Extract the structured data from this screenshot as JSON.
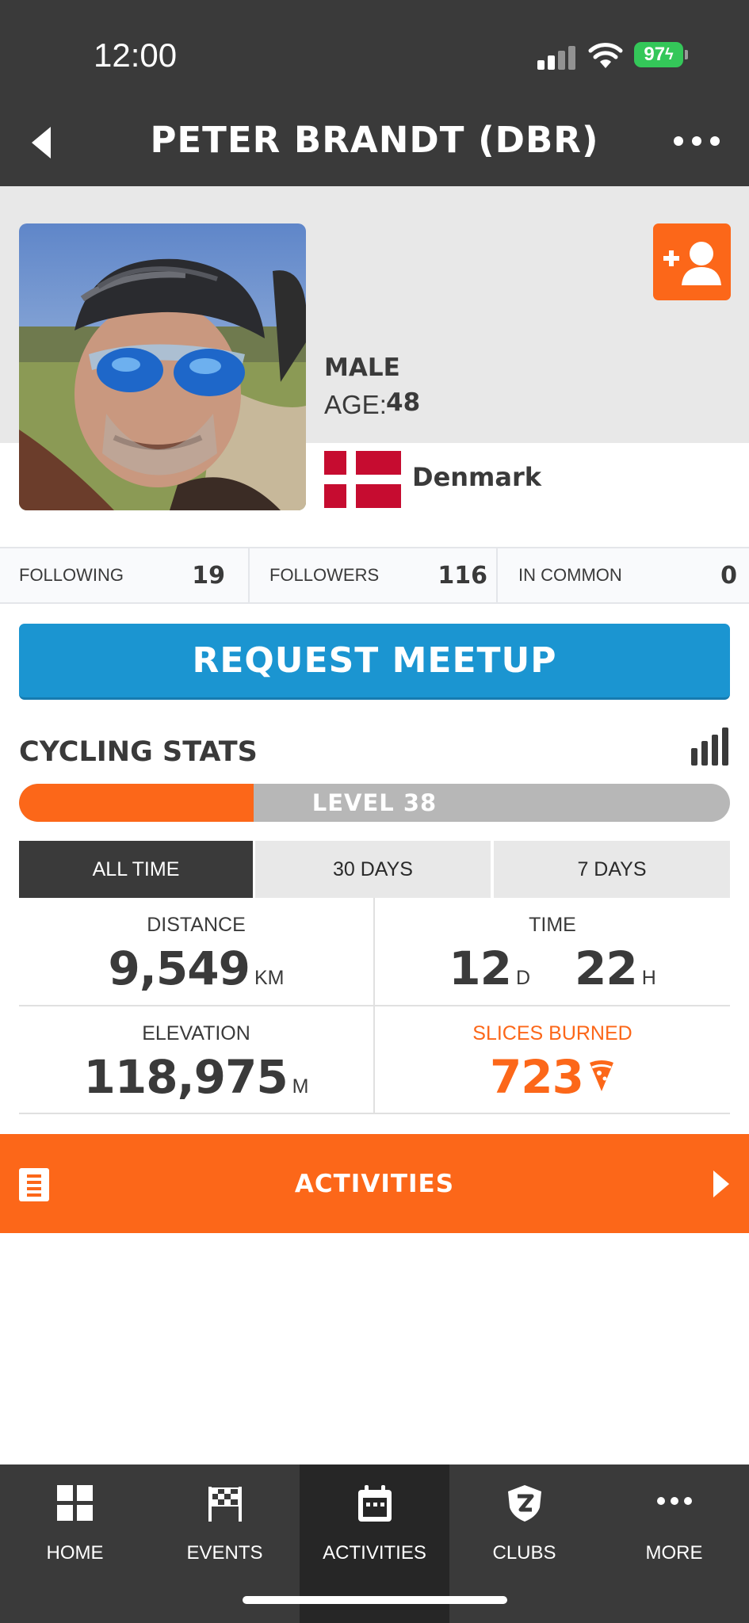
{
  "status_bar": {
    "time": "12:00",
    "battery": "97"
  },
  "header": {
    "title": "PETER BRANDT (DBR)"
  },
  "profile": {
    "gender": "MALE",
    "age_label": "AGE:",
    "age": "48",
    "country": "Denmark"
  },
  "social": {
    "following_label": "FOLLOWING",
    "following": "19",
    "followers_label": "FOLLOWERS",
    "followers": "116",
    "in_common_label": "IN COMMON",
    "in_common": "0"
  },
  "meetup_button": "REQUEST MEETUP",
  "cycling_stats": {
    "title": "CYCLING STATS",
    "level_text": "LEVEL 38",
    "level_progress_fraction": 0.33,
    "tabs": [
      "ALL TIME",
      "30 DAYS",
      "7 DAYS"
    ],
    "distance_label": "DISTANCE",
    "distance_value": "9,549",
    "distance_unit": "KM",
    "time_label": "TIME",
    "time_days": "12",
    "time_days_unit": "D",
    "time_hours": "22",
    "time_hours_unit": "H",
    "elevation_label": "ELEVATION",
    "elevation_value": "118,975",
    "elevation_unit": "M",
    "slices_label": "SLICES BURNED",
    "slices_value": "723"
  },
  "activities_bar": {
    "label": "ACTIVITIES"
  },
  "nav": [
    {
      "label": "HOME"
    },
    {
      "label": "EVENTS"
    },
    {
      "label": "ACTIVITIES"
    },
    {
      "label": "CLUBS"
    },
    {
      "label": "MORE"
    }
  ],
  "colors": {
    "accent_orange": "#fc6719",
    "meetup_blue": "#1b95d1",
    "dark_gray": "#3a3a3a",
    "battery_green": "#34c759",
    "denmark_red": "#c60c30"
  }
}
